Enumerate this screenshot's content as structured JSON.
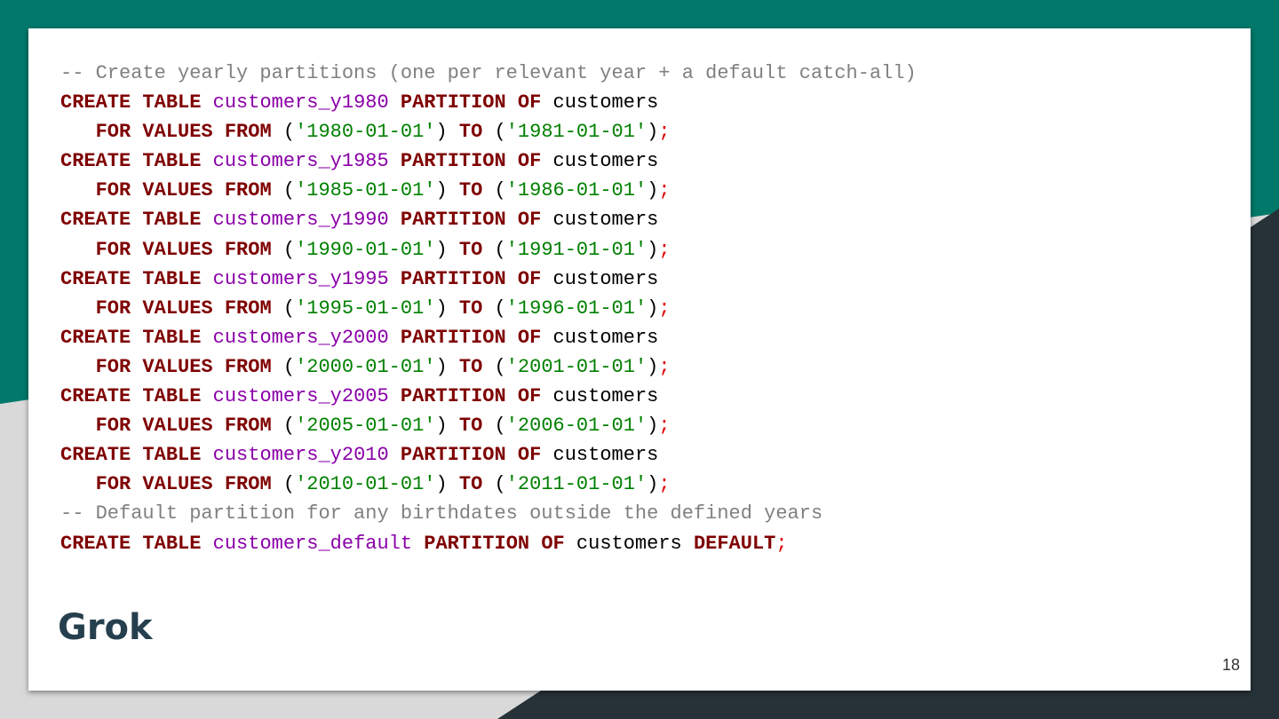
{
  "slide": {
    "title": "Grok",
    "page_number": "18"
  },
  "code": {
    "comment_1": "-- Create yearly partitions (one per relevant year + a default catch-all)",
    "partitions": [
      {
        "name": "customers_y1980",
        "from": "'1980-01-01'",
        "to": "'1981-01-01'"
      },
      {
        "name": "customers_y1985",
        "from": "'1985-01-01'",
        "to": "'1986-01-01'"
      },
      {
        "name": "customers_y1990",
        "from": "'1990-01-01'",
        "to": "'1991-01-01'"
      },
      {
        "name": "customers_y1995",
        "from": "'1995-01-01'",
        "to": "'1996-01-01'"
      },
      {
        "name": "customers_y2000",
        "from": "'2000-01-01'",
        "to": "'2001-01-01'"
      },
      {
        "name": "customers_y2005",
        "from": "'2005-01-01'",
        "to": "'2006-01-01'"
      },
      {
        "name": "customers_y2010",
        "from": "'2010-01-01'",
        "to": "'2011-01-01'"
      }
    ],
    "comment_2": "-- Default partition for any birthdates outside the defined years",
    "default_table": "customers_default",
    "parent_table": "customers",
    "kw_create": "CREATE",
    "kw_table": "TABLE",
    "kw_partition": "PARTITION",
    "kw_of": "OF",
    "kw_for": "FOR",
    "kw_values": "VALUES",
    "kw_from": "FROM",
    "kw_to": "TO",
    "kw_default": "DEFAULT"
  },
  "colors": {
    "background_teal": "#00796b",
    "background_dark": "#263238",
    "background_light": "#d9d9d9",
    "keyword": "#7f0000",
    "identifier": "#8a00a8",
    "string": "#008000",
    "comment": "#808080",
    "semicolon": "#e00000",
    "title": "#263f4e"
  }
}
